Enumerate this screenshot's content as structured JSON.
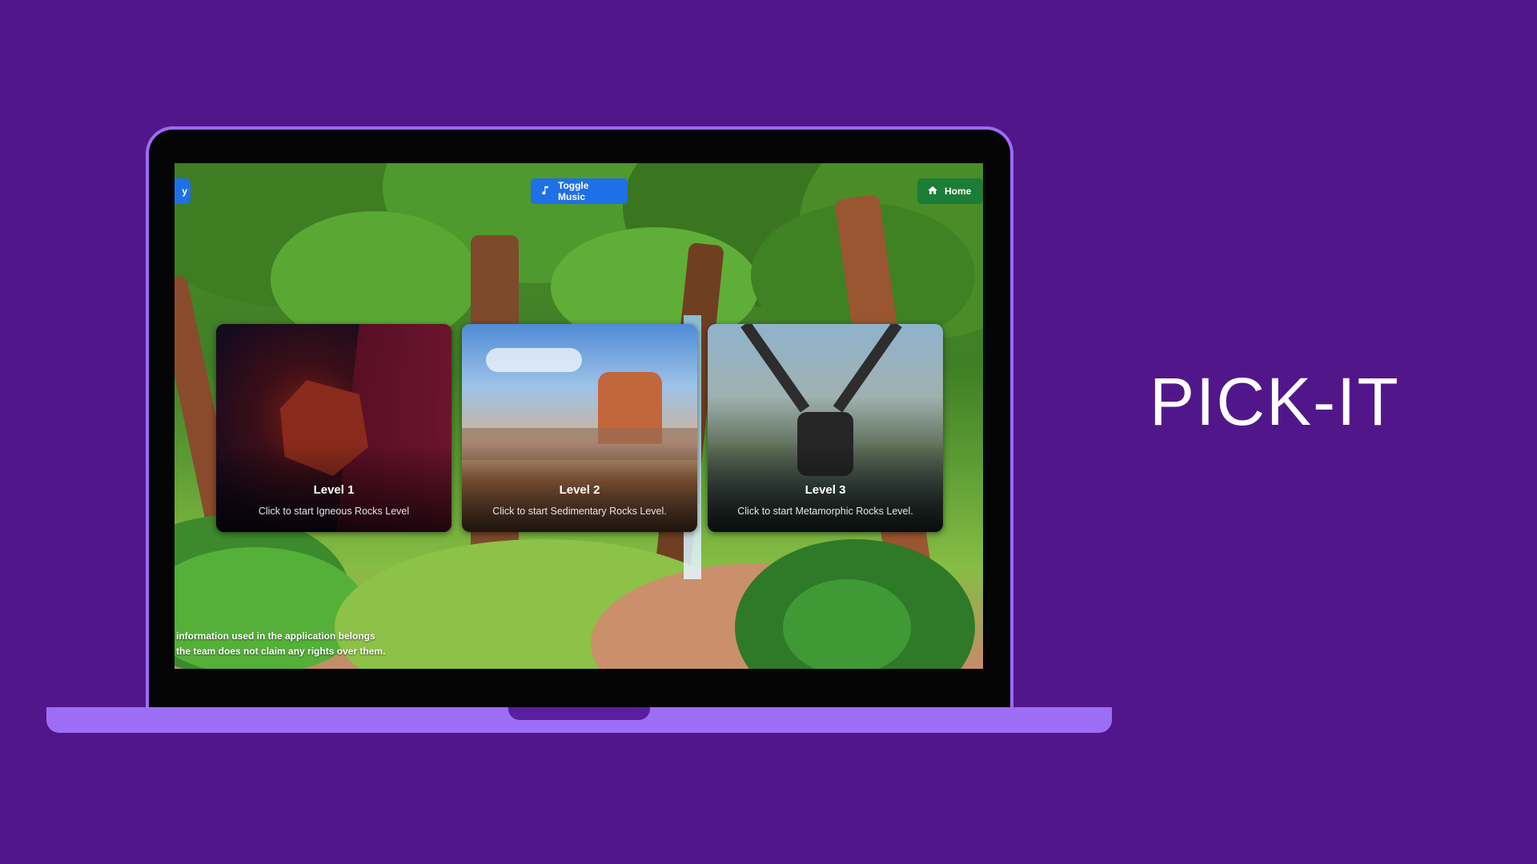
{
  "brand": {
    "title": "PICK-IT"
  },
  "app": {
    "buttons": {
      "left_label": "y",
      "music_label": "Toggle Music",
      "home_label": "Home"
    },
    "levels": [
      {
        "title": "Level 1",
        "description": "Click to start Igneous Rocks Level"
      },
      {
        "title": "Level 2",
        "description": "Click to start Sedimentary Rocks Level."
      },
      {
        "title": "Level 3",
        "description": "Click to start Metamorphic Rocks Level."
      }
    ],
    "footer": {
      "line1": "information used in the application belongs",
      "line2": "the team does not claim any rights over them."
    }
  },
  "colors": {
    "background": "#51178a",
    "laptop_accent": "#9c6ef6",
    "button_blue": "#1f6fe6",
    "button_green": "#1b7d36"
  }
}
